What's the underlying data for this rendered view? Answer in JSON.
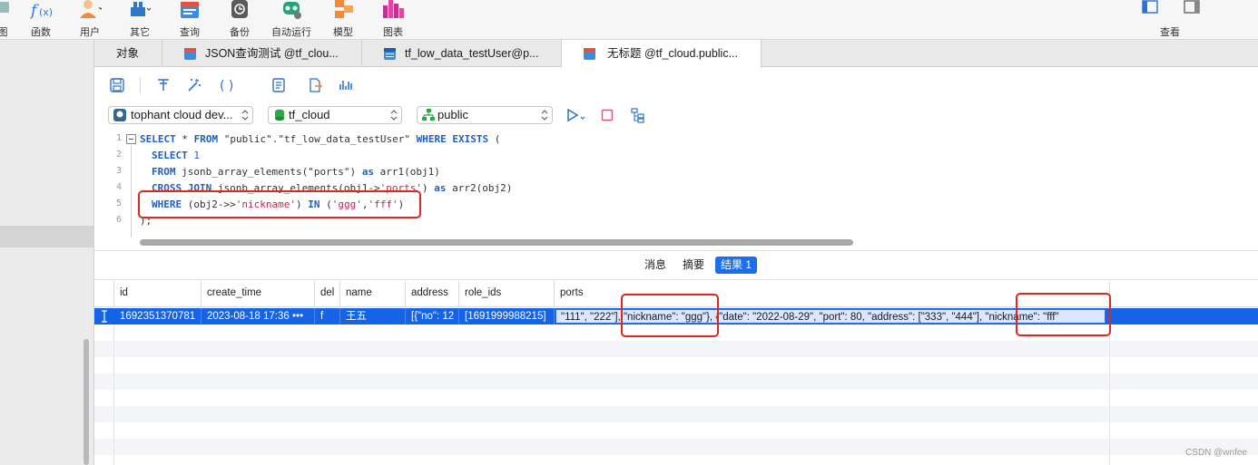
{
  "toolbar": {
    "items": [
      {
        "label": "图",
        "icon": "view-icon"
      },
      {
        "label": "函数",
        "icon": "function-icon"
      },
      {
        "label": "用户",
        "icon": "user-icon"
      },
      {
        "label": "其它",
        "icon": "other-icon"
      },
      {
        "label": "查询",
        "icon": "query-icon"
      },
      {
        "label": "备份",
        "icon": "backup-icon"
      },
      {
        "label": "自动运行",
        "icon": "automation-icon"
      },
      {
        "label": "模型",
        "icon": "model-icon"
      },
      {
        "label": "图表",
        "icon": "chart-icon"
      }
    ],
    "view_label": "查看"
  },
  "tabs": [
    {
      "label": "对象",
      "icon": ""
    },
    {
      "label": "JSON查询测试 @tf_clou...",
      "icon": "query-tab-icon"
    },
    {
      "label": "tf_low_data_testUser@p...",
      "icon": "table-tab-icon"
    },
    {
      "label": "无标题 @tf_cloud.public...",
      "icon": "query-tab-icon"
    }
  ],
  "selectors": {
    "connection": "tophant cloud dev...",
    "database": "tf_cloud",
    "schema": "public"
  },
  "editor": {
    "line_numbers": [
      "1",
      "2",
      "3",
      "4",
      "5",
      "6"
    ],
    "lines": {
      "l1_kw1": "SELECT",
      "l1_mid": " * ",
      "l1_kw2": "FROM",
      "l1_tbl": " \"public\".\"tf_low_data_testUser\" ",
      "l1_kw3": "WHERE EXISTS",
      "l1_end": " (",
      "l2_kw": "SELECT",
      "l2_num": " 1",
      "l3_kw": "FROM",
      "l3_fn": " jsonb_array_elements(\"ports\") ",
      "l3_as": "as",
      "l3_end": " arr1(obj1)",
      "l4_kw": "CROSS JOIN",
      "l4_fn": " jsonb_array_elements(obj1->",
      "l4_str": "'ports'",
      "l4_mid": ") ",
      "l4_as": "as",
      "l4_end": " arr2(obj2)",
      "l5_kw": "WHERE",
      "l5_mid": " (obj2->>",
      "l5_str": "'nickname'",
      "l5_mid2": ") ",
      "l5_in": "IN",
      "l5_p": " (",
      "l5_s1": "'ggg'",
      "l5_c": ",",
      "l5_s2": "'fff'",
      "l5_e": ")",
      "l6": ");"
    }
  },
  "result_tabs": [
    {
      "label": "消息",
      "active": false
    },
    {
      "label": "摘要",
      "active": false
    },
    {
      "label": "结果 1",
      "active": true
    }
  ],
  "grid": {
    "columns": [
      "id",
      "create_time",
      "del",
      "name",
      "address",
      "role_ids",
      "ports"
    ],
    "row": {
      "id": "1692351370781",
      "create_time": "2023-08-18 17:36",
      "create_time_more": "•••",
      "del": "f",
      "name": "王五",
      "address": "[{\"no\": 12",
      "role_ids": "[1691999988215]",
      "ports": "\"111\", \"222\"], \"nickname\": \"ggg\"}, {\"date\": \"2022-08-29\", \"port\": 80, \"address\": [\"333\", \"444\"], \"nickname\": \"fff\""
    }
  },
  "watermark": "CSDN @wnfee",
  "colors": {
    "accent": "#1a6ff0",
    "highlight": "#e0261f",
    "keyword": "#1f5fc4",
    "string": "#c4264e"
  }
}
